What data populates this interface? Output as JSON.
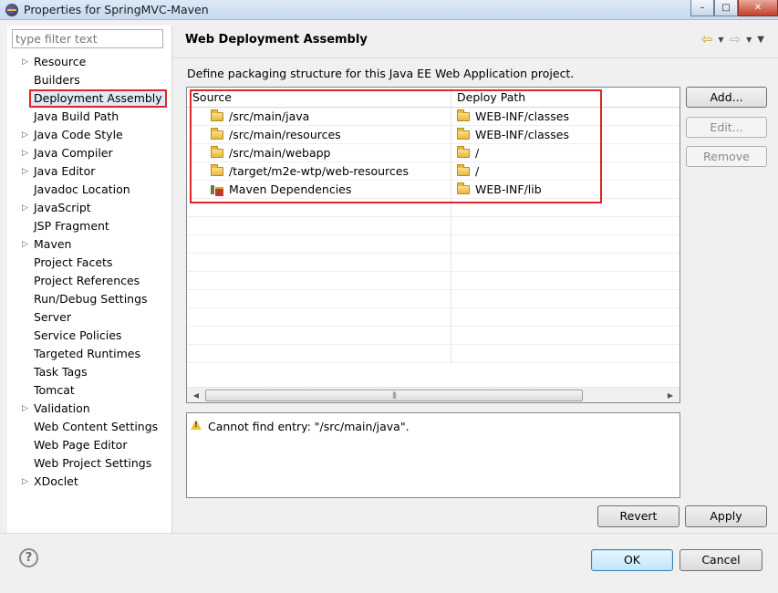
{
  "window": {
    "title": "Properties for SpringMVC-Maven",
    "controls": [
      "minimize-icon",
      "maximize-icon",
      "close-icon"
    ]
  },
  "filter": {
    "placeholder": "type filter text"
  },
  "tree": {
    "items": [
      {
        "label": "Resource",
        "expandable": true
      },
      {
        "label": "Builders",
        "expandable": false
      },
      {
        "label": "Deployment Assembly",
        "expandable": false,
        "selected": true
      },
      {
        "label": "Java Build Path",
        "expandable": false
      },
      {
        "label": "Java Code Style",
        "expandable": true
      },
      {
        "label": "Java Compiler",
        "expandable": true
      },
      {
        "label": "Java Editor",
        "expandable": true
      },
      {
        "label": "Javadoc Location",
        "expandable": false
      },
      {
        "label": "JavaScript",
        "expandable": true
      },
      {
        "label": "JSP Fragment",
        "expandable": false
      },
      {
        "label": "Maven",
        "expandable": true
      },
      {
        "label": "Project Facets",
        "expandable": false
      },
      {
        "label": "Project References",
        "expandable": false
      },
      {
        "label": "Run/Debug Settings",
        "expandable": false
      },
      {
        "label": "Server",
        "expandable": false
      },
      {
        "label": "Service Policies",
        "expandable": false
      },
      {
        "label": "Targeted Runtimes",
        "expandable": false
      },
      {
        "label": "Task Tags",
        "expandable": false
      },
      {
        "label": "Tomcat",
        "expandable": false
      },
      {
        "label": "Validation",
        "expandable": true
      },
      {
        "label": "Web Content Settings",
        "expandable": false
      },
      {
        "label": "Web Page Editor",
        "expandable": false
      },
      {
        "label": "Web Project Settings",
        "expandable": false
      },
      {
        "label": "XDoclet",
        "expandable": true
      }
    ]
  },
  "page": {
    "title": "Web Deployment Assembly",
    "description": "Define packaging structure for this Java EE Web Application project."
  },
  "table": {
    "columns": {
      "source": "Source",
      "deploy_path": "Deploy Path"
    },
    "rows": [
      {
        "source": "/src/main/java",
        "deploy": "WEB-INF/classes",
        "icon": "folder-icon"
      },
      {
        "source": "/src/main/resources",
        "deploy": "WEB-INF/classes",
        "icon": "folder-icon"
      },
      {
        "source": "/src/main/webapp",
        "deploy": "/",
        "icon": "folder-icon"
      },
      {
        "source": "/target/m2e-wtp/web-resources",
        "deploy": "/",
        "icon": "folder-icon"
      },
      {
        "source": "Maven Dependencies",
        "deploy": "WEB-INF/lib",
        "icon": "library-icon"
      }
    ]
  },
  "side_buttons": {
    "add": "Add...",
    "edit": "Edit...",
    "remove": "Remove"
  },
  "message": {
    "text": "Cannot find entry: \"/src/main/java\".",
    "icon": "warning-icon"
  },
  "buttons": {
    "revert": "Revert",
    "apply": "Apply",
    "ok": "OK",
    "cancel": "Cancel"
  },
  "help": {
    "label": "?"
  },
  "colors": {
    "highlight": "#e0252a",
    "selection": "#dfe9f7"
  }
}
